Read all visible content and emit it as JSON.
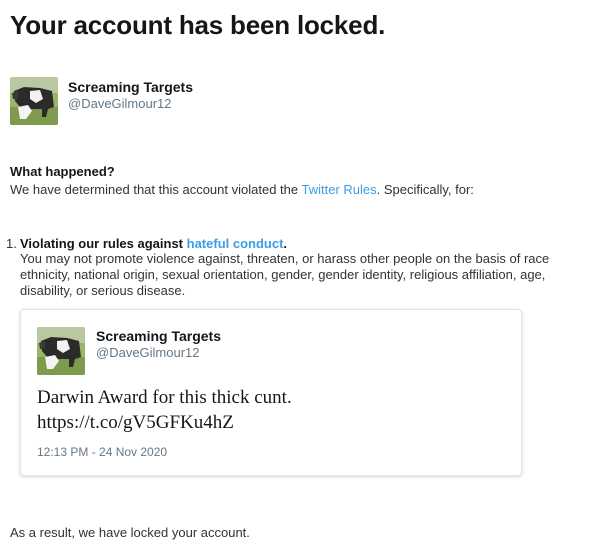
{
  "page": {
    "title": "Your account has been locked."
  },
  "account": {
    "name": "Screaming Targets",
    "handle": "@DaveGilmour12",
    "avatar_icon": "avatar-photo"
  },
  "what_happened": {
    "heading": "What happened?",
    "text_before": "We have determined that this account violated the ",
    "link_text": "Twitter Rules",
    "text_after": ". Specifically, for:"
  },
  "violation": {
    "number": "1.",
    "heading_before": "Violating our rules against ",
    "heading_link": "hateful conduct",
    "heading_after": ".",
    "description": "You may not promote violence against, threaten, or harass other people on the basis of race ethnicity, national origin, sexual orientation, gender, gender identity, religious affiliation, age, disability, or serious disease."
  },
  "tweet": {
    "name": "Screaming Targets",
    "handle": "@DaveGilmour12",
    "text_line1": "Darwin Award for this thick cunt.",
    "text_line2": "https://t.co/gV5GFKu4hZ",
    "timestamp": "12:13 PM - 24 Nov 2020"
  },
  "result_text": "As a result, we have locked your account.",
  "colors": {
    "link": "#3a9ee8",
    "muted": "#657786",
    "text": "#14171a",
    "body_text": "#333333",
    "card_border": "#e1e8ed"
  }
}
